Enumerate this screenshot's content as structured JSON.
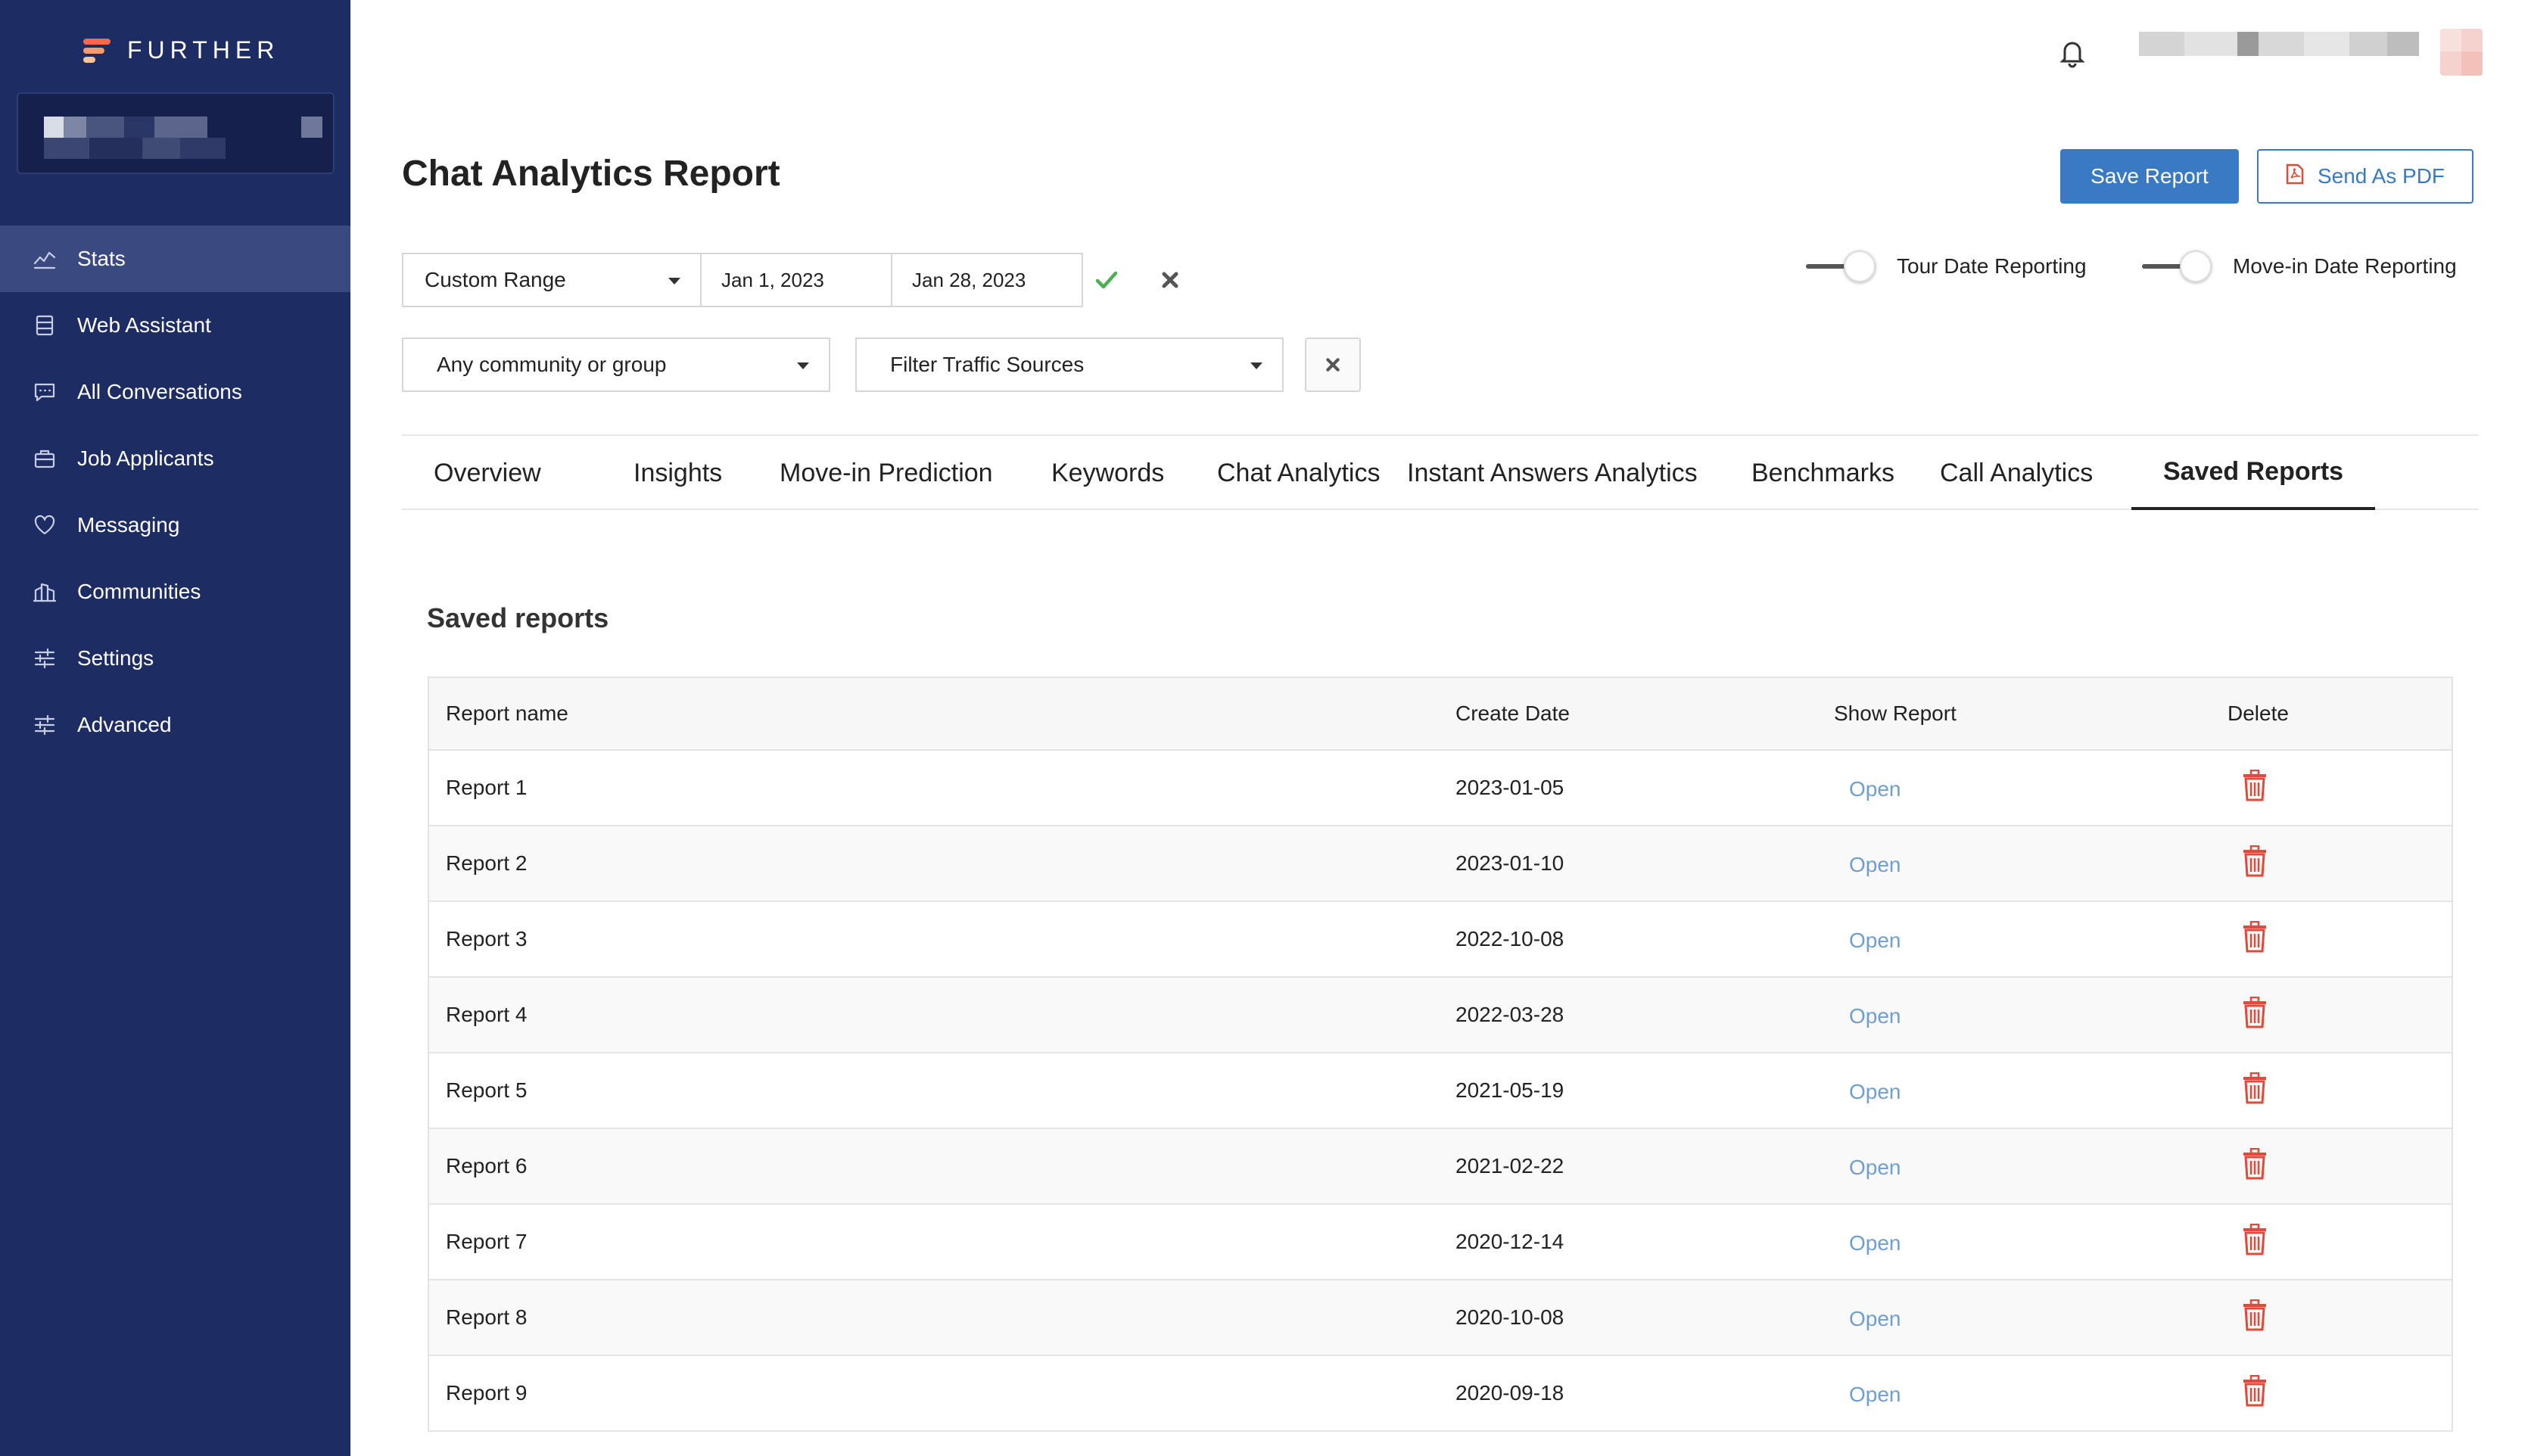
{
  "brand": {
    "name": "FURTHER",
    "colors": {
      "sidebar": "#1d2c62",
      "accent": "#3a7ac4",
      "danger": "#e04a3a",
      "link": "#6f9fd1",
      "success": "#4caf50"
    }
  },
  "sidebar": {
    "items": [
      {
        "label": "Stats",
        "icon": "stats-icon",
        "active": true
      },
      {
        "label": "Web Assistant",
        "icon": "web-assistant-icon"
      },
      {
        "label": "All Conversations",
        "icon": "conversations-icon"
      },
      {
        "label": "Job Applicants",
        "icon": "briefcase-icon"
      },
      {
        "label": "Messaging",
        "icon": "heart-icon"
      },
      {
        "label": "Communities",
        "icon": "building-icon"
      },
      {
        "label": "Settings",
        "icon": "sliders-icon"
      },
      {
        "label": "Advanced",
        "icon": "sliders-icon"
      }
    ]
  },
  "header": {
    "title": "Chat Analytics Report",
    "save_label": "Save Report",
    "pdf_label": "Send As PDF"
  },
  "filters": {
    "range_select": "Custom Range",
    "start_date": "Jan 1, 2023",
    "end_date": "Jan 28, 2023",
    "community_select": "Any community or group",
    "traffic_select": "Filter Traffic Sources",
    "tour_toggle_label": "Tour Date Reporting",
    "movein_toggle_label": "Move-in Date Reporting"
  },
  "tabs": [
    {
      "label": "Overview"
    },
    {
      "label": "Insights"
    },
    {
      "label": "Move-in Prediction"
    },
    {
      "label": "Keywords"
    },
    {
      "label": "Chat Analytics"
    },
    {
      "label": "Instant Answers Analytics"
    },
    {
      "label": "Benchmarks"
    },
    {
      "label": "Call Analytics"
    },
    {
      "label": "Saved Reports",
      "active": true
    }
  ],
  "saved_reports": {
    "title": "Saved reports",
    "columns": [
      "Report name",
      "Create Date",
      "Show Report",
      "Delete"
    ],
    "open_label": "Open",
    "rows": [
      {
        "name": "Report 1",
        "date": "2023-01-05"
      },
      {
        "name": "Report 2",
        "date": "2023-01-10"
      },
      {
        "name": "Report 3",
        "date": "2022-10-08"
      },
      {
        "name": "Report 4",
        "date": "2022-03-28"
      },
      {
        "name": "Report 5",
        "date": "2021-05-19"
      },
      {
        "name": "Report 6",
        "date": "2021-02-22"
      },
      {
        "name": "Report 7",
        "date": "2020-12-14"
      },
      {
        "name": "Report 8",
        "date": "2020-10-08"
      },
      {
        "name": "Report 9",
        "date": "2020-09-18"
      }
    ]
  }
}
